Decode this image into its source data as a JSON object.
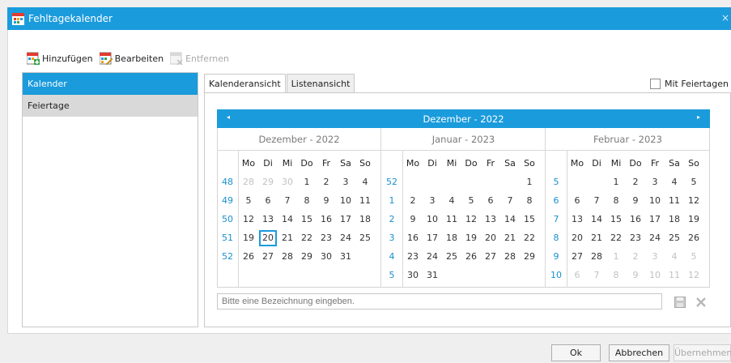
{
  "window": {
    "title": "Fehltagekalender",
    "close_glyph": "×"
  },
  "toolbar": {
    "add_label": "Hinzufügen",
    "edit_label": "Bearbeiten",
    "remove_label": "Entfernen"
  },
  "sidebar": {
    "items": [
      {
        "label": "Kalender"
      },
      {
        "label": "Feiertage"
      }
    ]
  },
  "tabs": [
    {
      "label": "Kalenderansicht"
    },
    {
      "label": "Listenansicht"
    }
  ],
  "holidays_checkbox": {
    "label": "Mit Feiertagen",
    "checked": false
  },
  "calendar": {
    "header_title": "Dezember - 2022",
    "prev_glyph": "◂",
    "next_glyph": "▸",
    "day_names": [
      "Mo",
      "Di",
      "Mi",
      "Do",
      "Fr",
      "Sa",
      "So"
    ],
    "months": [
      {
        "title": "Dezember - 2022",
        "weeks": [
          "48",
          "49",
          "50",
          "51",
          "52",
          ""
        ],
        "rows": [
          [
            [
              "28",
              1
            ],
            [
              "29",
              1
            ],
            [
              "30",
              1
            ],
            [
              "1",
              0
            ],
            [
              "2",
              0
            ],
            [
              "3",
              0
            ],
            [
              "4",
              0
            ]
          ],
          [
            [
              "5",
              0
            ],
            [
              "6",
              0
            ],
            [
              "7",
              0
            ],
            [
              "8",
              0
            ],
            [
              "9",
              0
            ],
            [
              "10",
              0
            ],
            [
              "11",
              0
            ]
          ],
          [
            [
              "12",
              0
            ],
            [
              "13",
              0
            ],
            [
              "14",
              0
            ],
            [
              "15",
              0
            ],
            [
              "16",
              0
            ],
            [
              "17",
              0
            ],
            [
              "18",
              0
            ]
          ],
          [
            [
              "19",
              0
            ],
            [
              "20",
              2
            ],
            [
              "21",
              0
            ],
            [
              "22",
              0
            ],
            [
              "23",
              0
            ],
            [
              "24",
              0
            ],
            [
              "25",
              0
            ]
          ],
          [
            [
              "26",
              0
            ],
            [
              "27",
              0
            ],
            [
              "28",
              0
            ],
            [
              "29",
              0
            ],
            [
              "30",
              0
            ],
            [
              "31",
              0
            ],
            [
              "",
              0
            ]
          ],
          [
            [
              "",
              0
            ],
            [
              "",
              0
            ],
            [
              "",
              0
            ],
            [
              "",
              0
            ],
            [
              "",
              0
            ],
            [
              "",
              0
            ],
            [
              "",
              0
            ]
          ]
        ]
      },
      {
        "title": "Januar - 2023",
        "weeks": [
          "52",
          "1",
          "2",
          "3",
          "4",
          "5"
        ],
        "rows": [
          [
            [
              "",
              0
            ],
            [
              "",
              0
            ],
            [
              "",
              0
            ],
            [
              "",
              0
            ],
            [
              "",
              0
            ],
            [
              "",
              0
            ],
            [
              "1",
              0
            ]
          ],
          [
            [
              "2",
              0
            ],
            [
              "3",
              0
            ],
            [
              "4",
              0
            ],
            [
              "5",
              0
            ],
            [
              "6",
              0
            ],
            [
              "7",
              0
            ],
            [
              "8",
              0
            ]
          ],
          [
            [
              "9",
              0
            ],
            [
              "10",
              0
            ],
            [
              "11",
              0
            ],
            [
              "12",
              0
            ],
            [
              "13",
              0
            ],
            [
              "14",
              0
            ],
            [
              "15",
              0
            ]
          ],
          [
            [
              "16",
              0
            ],
            [
              "17",
              0
            ],
            [
              "18",
              0
            ],
            [
              "19",
              0
            ],
            [
              "20",
              0
            ],
            [
              "21",
              0
            ],
            [
              "22",
              0
            ]
          ],
          [
            [
              "23",
              0
            ],
            [
              "24",
              0
            ],
            [
              "25",
              0
            ],
            [
              "26",
              0
            ],
            [
              "27",
              0
            ],
            [
              "28",
              0
            ],
            [
              "29",
              0
            ]
          ],
          [
            [
              "30",
              0
            ],
            [
              "31",
              0
            ],
            [
              "",
              0
            ],
            [
              "",
              0
            ],
            [
              "",
              0
            ],
            [
              "",
              0
            ],
            [
              "",
              0
            ]
          ]
        ]
      },
      {
        "title": "Februar - 2023",
        "weeks": [
          "5",
          "6",
          "7",
          "8",
          "9",
          "10"
        ],
        "rows": [
          [
            [
              "",
              0
            ],
            [
              "",
              0
            ],
            [
              "1",
              0
            ],
            [
              "2",
              0
            ],
            [
              "3",
              0
            ],
            [
              "4",
              0
            ],
            [
              "5",
              0
            ]
          ],
          [
            [
              "6",
              0
            ],
            [
              "7",
              0
            ],
            [
              "8",
              0
            ],
            [
              "9",
              0
            ],
            [
              "10",
              0
            ],
            [
              "11",
              0
            ],
            [
              "12",
              0
            ]
          ],
          [
            [
              "13",
              0
            ],
            [
              "14",
              0
            ],
            [
              "15",
              0
            ],
            [
              "16",
              0
            ],
            [
              "17",
              0
            ],
            [
              "18",
              0
            ],
            [
              "19",
              0
            ]
          ],
          [
            [
              "20",
              0
            ],
            [
              "21",
              0
            ],
            [
              "22",
              0
            ],
            [
              "23",
              0
            ],
            [
              "24",
              0
            ],
            [
              "25",
              0
            ],
            [
              "26",
              0
            ]
          ],
          [
            [
              "27",
              0
            ],
            [
              "28",
              0
            ],
            [
              "1",
              1
            ],
            [
              "2",
              1
            ],
            [
              "3",
              1
            ],
            [
              "4",
              1
            ],
            [
              "5",
              1
            ]
          ],
          [
            [
              "6",
              1
            ],
            [
              "7",
              1
            ],
            [
              "8",
              1
            ],
            [
              "9",
              1
            ],
            [
              "10",
              1
            ],
            [
              "11",
              1
            ],
            [
              "12",
              1
            ]
          ]
        ]
      }
    ]
  },
  "description": {
    "placeholder": "Bitte eine Bezeichnung eingeben.",
    "value": ""
  },
  "footer": {
    "ok_label": "Ok",
    "cancel_label": "Abbrechen",
    "apply_label": "Übernehmen"
  },
  "colors": {
    "accent": "#1a9bdc",
    "week_number": "#1a8fd0",
    "other_month_day": "#c2c2c2"
  },
  "icons": [
    "calendar-app-icon",
    "calendar-add-icon",
    "calendar-edit-icon",
    "calendar-remove-icon",
    "save-icon",
    "delete-icon"
  ]
}
